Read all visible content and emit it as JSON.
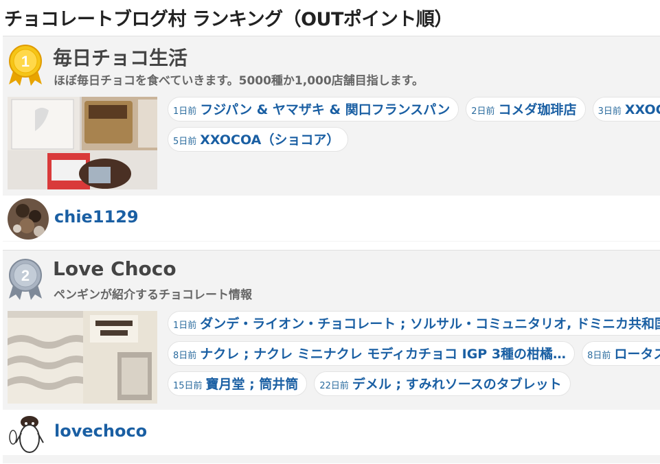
{
  "page": {
    "title": "チョコレートブログ村 ランキング（OUTポイント順）"
  },
  "rankings": [
    {
      "rank": "1",
      "blog_title": "毎日チョコ生活",
      "description": "ほぼ毎日チョコを食べていきます。5000種か1,000店舗目指します。",
      "author": "chie1129",
      "medal_color": "#f2b705",
      "posts": [
        [
          {
            "date": "1日前",
            "title": "フジパン & ヤマザキ & 関口フランスパン"
          },
          {
            "date": "2日前",
            "title": "コメダ珈琲店"
          },
          {
            "date": "3日前",
            "title": "XXOCOA"
          }
        ],
        [
          {
            "date": "5日前",
            "title": "XXOCOA（ショコア）"
          }
        ]
      ]
    },
    {
      "rank": "2",
      "blog_title": "Love Choco",
      "description": "ペンギンが紹介するチョコレート情報",
      "author": "lovechoco",
      "medal_color": "#9aa6b5",
      "posts": [
        [
          {
            "date": "1日前",
            "title": "ダンデ・ライオン・チョコレート ; ソルサル・コミュニタリオ, ドミニカ共和国"
          }
        ],
        [
          {
            "date": "8日前",
            "title": "ナクレ ; ナクレ ミニナクレ モディカチョコ IGP 3種の柑橘…"
          },
          {
            "date": "8日前",
            "title": "ロータス"
          }
        ],
        [
          {
            "date": "15日前",
            "title": "寶月堂 ; 筒井筒"
          },
          {
            "date": "22日前",
            "title": "デメル ; すみれソースのタブレット"
          }
        ]
      ]
    }
  ],
  "colors": {
    "link": "#1a5fa3",
    "card_bg": "#f3f3f3",
    "gold": "#f2b705",
    "silver": "#9aa6b5"
  }
}
